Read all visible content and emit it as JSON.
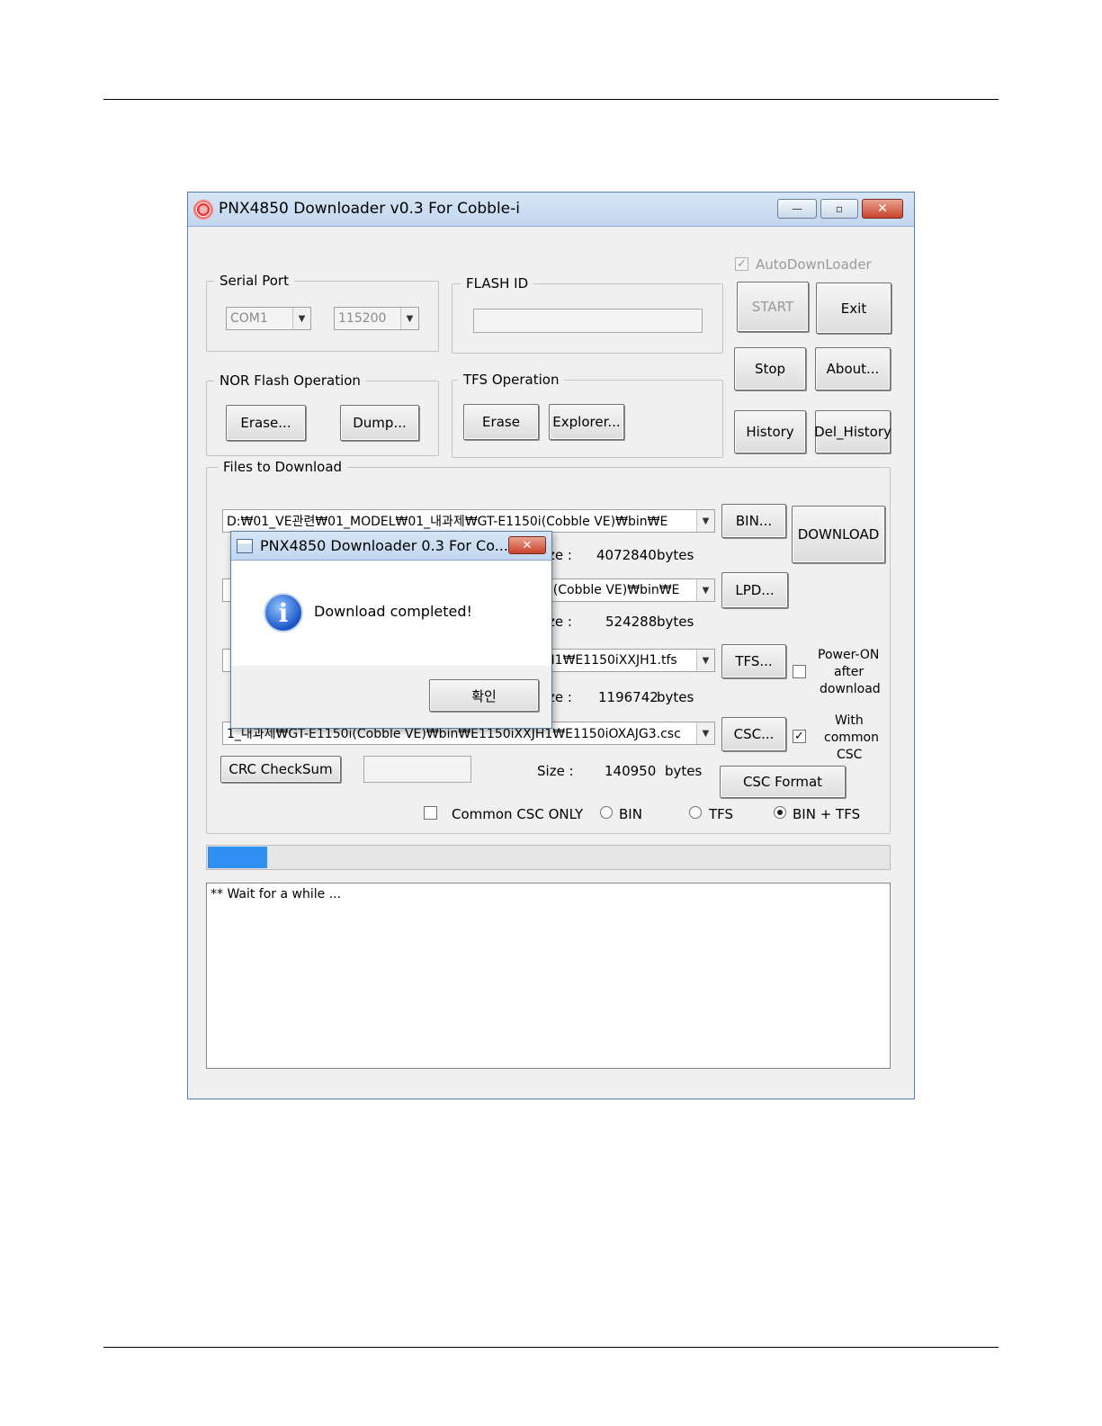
{
  "window": {
    "title": "PNX4850 Downloader v0.3 For Cobble-i",
    "minimize_label": "—",
    "maximize_label": "▫",
    "close_label": "✕"
  },
  "auto_downloader": {
    "label": "AutoDownLoader",
    "checked": true
  },
  "serial_port": {
    "label": "Serial Port",
    "port": "COM1",
    "baud": "115200"
  },
  "flash_id": {
    "label": "FLASH ID",
    "value": ""
  },
  "buttons": {
    "start": "START",
    "exit": "Exit",
    "stop": "Stop",
    "about": "About...",
    "history": "History",
    "del_history": "Del_History"
  },
  "nor_flash": {
    "label": "NOR Flash Operation",
    "erase": "Erase...",
    "dump": "Dump..."
  },
  "tfs_operation": {
    "label": "TFS Operation",
    "erase": "Erase",
    "explorer": "Explorer..."
  },
  "files": {
    "label": "Files to Download",
    "bin_path": "D:₩01_VE관련₩01_MODEL₩01_내과제₩GT-E1150i(Cobble VE)₩bin₩E",
    "bin_button": "BIN...",
    "download_button": "DOWNLOAD",
    "bin_size_label": "ze :",
    "bin_size": "4072840",
    "bytes": "bytes",
    "lpd_path_tail": "0i(Cobble VE)₩bin₩E",
    "lpd_button": "LPD...",
    "lpd_size_label": "ze :",
    "lpd_size": "524288",
    "tfs_path_tail": "JH1₩E1150iXXJH1.tfs",
    "tfs_button": "TFS...",
    "tfs_size_label": "ze :",
    "tfs_size": "1196742",
    "power_on_label_1": "Power-ON",
    "power_on_label_2": "after",
    "power_on_label_3": "download",
    "csc_path": "1_내과제₩GT-E1150i(Cobble VE)₩bin₩E1150iXXJH1₩E1150iOXAJG3.csc",
    "csc_button": "CSC...",
    "common_csc_label_1": "With",
    "common_csc_label_2": "common",
    "common_csc_label_3": "CSC",
    "crc_button": "CRC CheckSum",
    "csc_size_label": "Size :",
    "csc_size": "140950",
    "csc_format_button": "CSC Format",
    "common_csc_only": "Common CSC ONLY",
    "radio_bin": "BIN",
    "radio_tfs": "TFS",
    "radio_bin_tfs": "BIN + TFS",
    "selected_mode": "BIN + TFS"
  },
  "progress": {
    "percent": 8.7
  },
  "log": {
    "text": "** Wait for a while ..."
  },
  "dialog": {
    "title": "PNX4850 Downloader 0.3 For Co...",
    "close_label": "✕",
    "message": "Download completed!",
    "ok_button": "확인"
  }
}
